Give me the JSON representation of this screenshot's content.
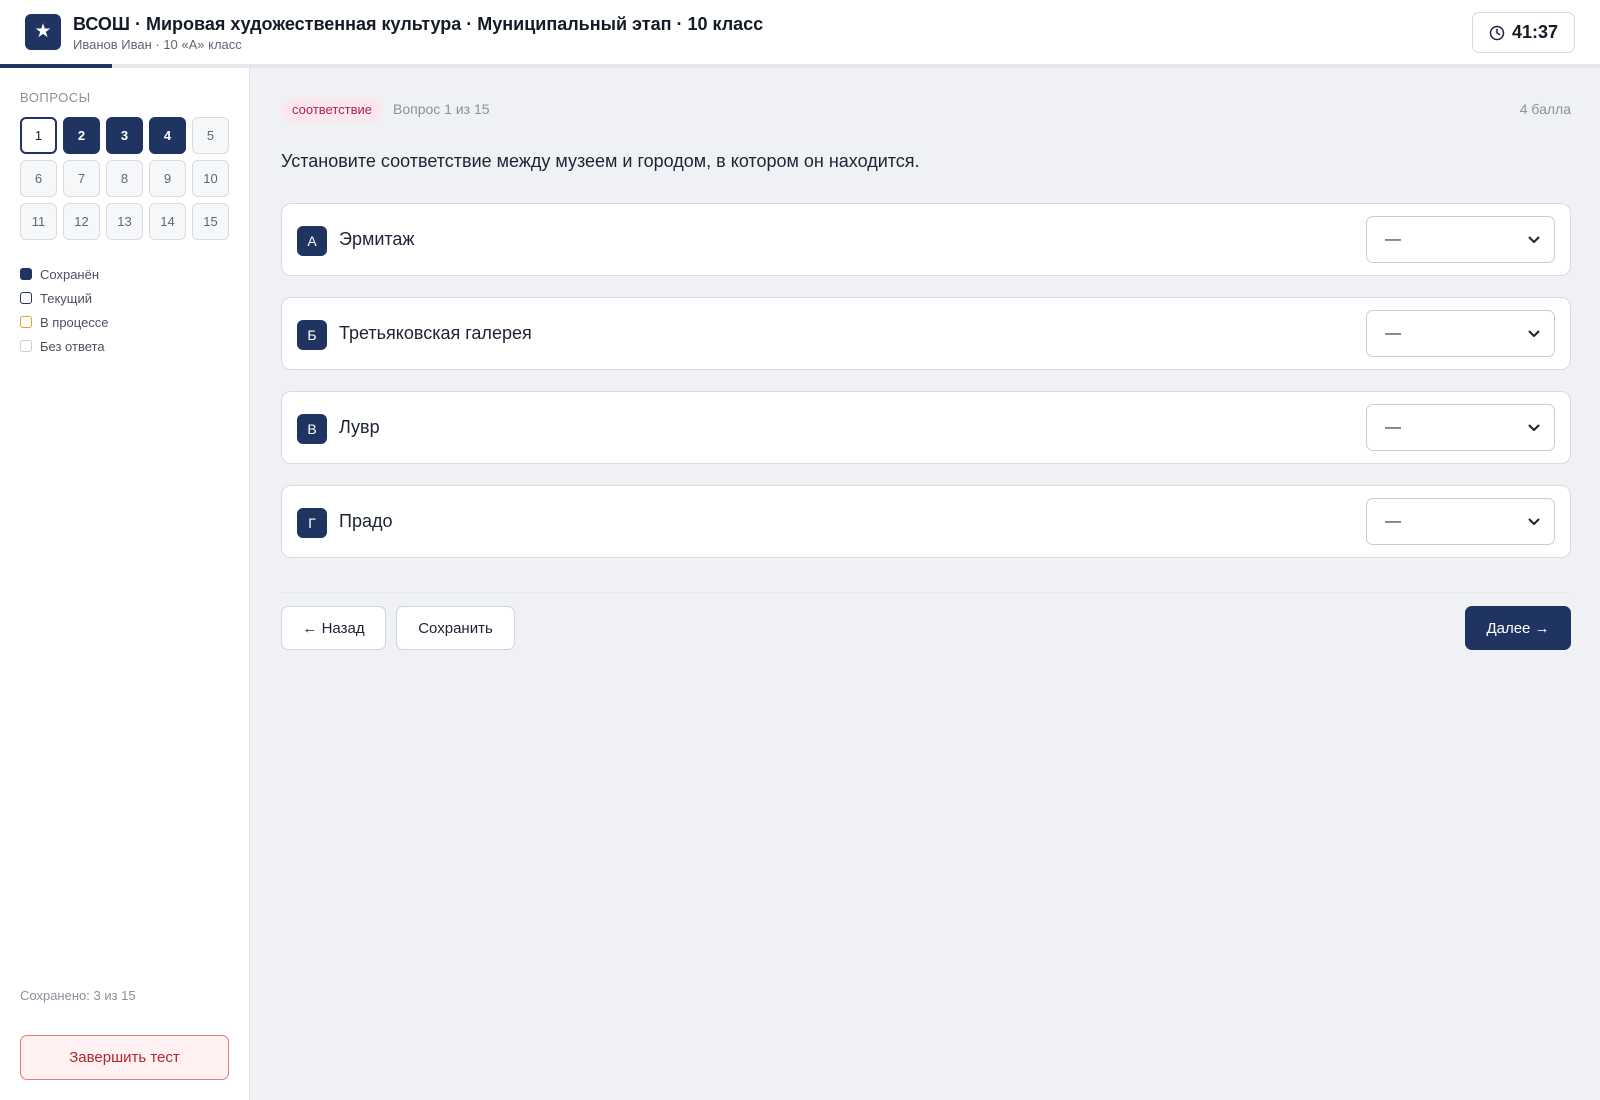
{
  "header": {
    "logo_glyph": "★",
    "title": "ВСОШ · Мировая художественная культура · Муниципальный этап · 10 класс",
    "subtitle": "Иванов Иван · 10 «А» класс",
    "timer": "41:37",
    "progress_fraction": 0.07
  },
  "sidebar": {
    "heading": "ВОПРОСЫ",
    "questions": [
      {
        "label": "1",
        "state": "current"
      },
      {
        "label": "2",
        "state": "saved"
      },
      {
        "label": "3",
        "state": "saved"
      },
      {
        "label": "4",
        "state": "saved"
      },
      {
        "label": "5",
        "state": "empty"
      },
      {
        "label": "6",
        "state": "empty"
      },
      {
        "label": "7",
        "state": "empty"
      },
      {
        "label": "8",
        "state": "empty"
      },
      {
        "label": "9",
        "state": "empty"
      },
      {
        "label": "10",
        "state": "empty"
      },
      {
        "label": "11",
        "state": "empty"
      },
      {
        "label": "12",
        "state": "empty"
      },
      {
        "label": "13",
        "state": "empty"
      },
      {
        "label": "14",
        "state": "empty"
      },
      {
        "label": "15",
        "state": "empty"
      }
    ],
    "legend": [
      {
        "key": "saved",
        "label": "Сохранён"
      },
      {
        "key": "current",
        "label": "Текущий"
      },
      {
        "key": "progress",
        "label": "В процессе"
      },
      {
        "key": "empty",
        "label": "Без ответа"
      }
    ],
    "saved_count": "Сохранено: 3 из 15",
    "finish_label": "Завершить тест"
  },
  "main": {
    "tag": "соответствие",
    "question_number": "Вопрос 1 из 15",
    "points": "4 балла",
    "question_text": "Установите соответствие между музеем и городом, в котором он находится.",
    "items": [
      {
        "letter": "А",
        "label": "Эрмитаж",
        "selected": "—"
      },
      {
        "letter": "Б",
        "label": "Третьяковская галерея",
        "selected": "—"
      },
      {
        "letter": "В",
        "label": "Лувр",
        "selected": "—"
      },
      {
        "letter": "Г",
        "label": "Прадо",
        "selected": "—"
      }
    ],
    "back_label": "← Назад",
    "save_label": "Сохранить",
    "next_label": "Далее →"
  },
  "colors": {
    "accent": "#1f3461",
    "tag_bg": "#fbe8ef",
    "tag_text": "#b0234f",
    "in_progress": "#e3a42c",
    "danger": "#b0282b"
  },
  "icons": {
    "logo": "star-icon",
    "timer": "clock-icon",
    "select": "chevron-down-icon"
  }
}
